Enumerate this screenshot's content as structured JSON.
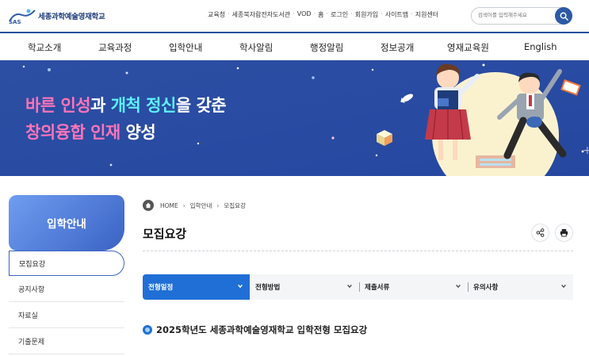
{
  "header": {
    "logo_text": "세종과학예술영재학교",
    "utility_links": [
      "교육청",
      "세종북자람전자도서관",
      "VOD",
      "홈",
      "로그인",
      "회원가입",
      "사이트맵",
      "지원센터"
    ],
    "search_placeholder": "검색어를 입력해주세요"
  },
  "nav": {
    "items": [
      "학교소개",
      "교육과정",
      "입학안내",
      "학사알림",
      "행정알림",
      "정보공개",
      "영재교육원",
      "English"
    ]
  },
  "banner": {
    "slogan_line1_a": "바른 인성",
    "slogan_line1_b": "과 ",
    "slogan_line1_c": "개척 정신",
    "slogan_line1_d": "을 갖춘",
    "slogan_line2_a": "창의융합 인재",
    "slogan_line2_b": " 양성"
  },
  "sidebar": {
    "title": "입학안내",
    "items": [
      "모집요강",
      "공지사항",
      "자료실",
      "기출문제"
    ],
    "active_index": 0
  },
  "breadcrumb": [
    "HOME",
    "입학안내",
    "모집요강"
  ],
  "page_title": "모집요강",
  "tabs": [
    "전형일정",
    "전형방법",
    "제출서류",
    "유의사항"
  ],
  "active_tab": 0,
  "section_title": "2025학년도 세종과학예술영재학교 입학전형 모집요강",
  "colors": {
    "brand_blue": "#1d4f9c",
    "accent_blue": "#1f6fd6",
    "banner_bg": "#2a4d9e",
    "slogan_pink": "#ff74b8",
    "slogan_cyan": "#5ef0ff"
  }
}
